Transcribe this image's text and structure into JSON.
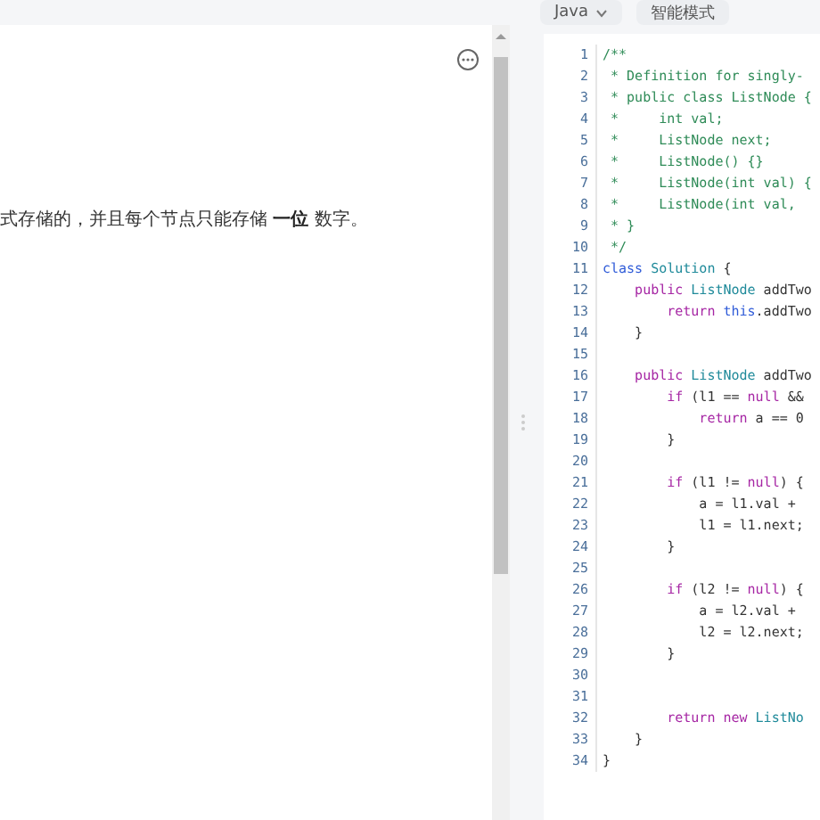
{
  "toolbar": {
    "buttons": [
      {
        "label": "Java",
        "kind": "dropdown"
      },
      {
        "label": "智能模式",
        "kind": "mode"
      }
    ]
  },
  "description": {
    "text": "式存储的，并且每个节点只能存储 **一位** 数字。"
  },
  "editor": {
    "lines": [
      {
        "number": "1",
        "tokens": [
          {
            "kind": "comment",
            "text": "/**"
          }
        ]
      },
      {
        "number": "2",
        "tokens": [
          {
            "kind": "comment",
            "text": " * Definition for singly-"
          }
        ]
      },
      {
        "number": "3",
        "tokens": [
          {
            "kind": "comment",
            "text": " * public class ListNode {"
          }
        ]
      },
      {
        "number": "4",
        "tokens": [
          {
            "kind": "comment",
            "text": " *     int val;"
          }
        ]
      },
      {
        "number": "5",
        "tokens": [
          {
            "kind": "comment",
            "text": " *     ListNode next;"
          }
        ]
      },
      {
        "number": "6",
        "tokens": [
          {
            "kind": "comment",
            "text": " *     ListNode() {}"
          }
        ]
      },
      {
        "number": "7",
        "tokens": [
          {
            "kind": "comment",
            "text": " *     ListNode(int val) {"
          }
        ]
      },
      {
        "number": "8",
        "tokens": [
          {
            "kind": "comment",
            "text": " *     ListNode(int val,"
          }
        ]
      },
      {
        "number": "9",
        "tokens": [
          {
            "kind": "comment",
            "text": " * }"
          }
        ]
      },
      {
        "number": "10",
        "tokens": [
          {
            "kind": "comment",
            "text": " */"
          }
        ]
      },
      {
        "number": "11",
        "tokens": [
          {
            "kind": "declaration",
            "text": "class"
          },
          {
            "kind": "type",
            "text": " Solution"
          },
          {
            "kind": "plain",
            "text": " {"
          }
        ]
      },
      {
        "number": "12",
        "tokens": [
          {
            "kind": "keyword",
            "text": "    public"
          },
          {
            "kind": "type",
            "text": " ListNode"
          },
          {
            "kind": "plain",
            "text": " addTwo"
          }
        ]
      },
      {
        "number": "13",
        "tokens": [
          {
            "kind": "keyword",
            "text": "        return"
          },
          {
            "kind": "declaration",
            "text": " this"
          },
          {
            "kind": "plain",
            "text": ".addTwo"
          }
        ]
      },
      {
        "number": "14",
        "tokens": [
          {
            "kind": "plain",
            "text": "    }"
          }
        ]
      },
      {
        "number": "15"
      },
      {
        "number": "16",
        "tokens": [
          {
            "kind": "keyword",
            "text": "    public"
          },
          {
            "kind": "type",
            "text": " ListNode"
          },
          {
            "kind": "plain",
            "text": " addTwo"
          }
        ]
      },
      {
        "number": "17",
        "tokens": [
          {
            "kind": "keyword",
            "text": "        if"
          },
          {
            "kind": "plain",
            "text": " (l1 =="
          },
          {
            "kind": "keyword",
            "text": " null"
          },
          {
            "kind": "plain",
            "text": " &&"
          }
        ]
      },
      {
        "number": "18",
        "tokens": [
          {
            "kind": "keyword",
            "text": "            return"
          },
          {
            "kind": "plain",
            "text": " a == 0"
          }
        ]
      },
      {
        "number": "19",
        "tokens": [
          {
            "kind": "plain",
            "text": "        }"
          }
        ]
      },
      {
        "number": "20"
      },
      {
        "number": "21",
        "tokens": [
          {
            "kind": "keyword",
            "text": "        if"
          },
          {
            "kind": "plain",
            "text": " (l1 !="
          },
          {
            "kind": "keyword",
            "text": " null"
          },
          {
            "kind": "plain",
            "text": ") {"
          }
        ]
      },
      {
        "number": "22",
        "tokens": [
          {
            "kind": "plain",
            "text": "            a = l1.val +"
          }
        ]
      },
      {
        "number": "23",
        "tokens": [
          {
            "kind": "plain",
            "text": "            l1 = l1.next;"
          }
        ]
      },
      {
        "number": "24",
        "tokens": [
          {
            "kind": "plain",
            "text": "        }"
          }
        ]
      },
      {
        "number": "25"
      },
      {
        "number": "26",
        "tokens": [
          {
            "kind": "keyword",
            "text": "        if"
          },
          {
            "kind": "plain",
            "text": " (l2 !="
          },
          {
            "kind": "keyword",
            "text": " null"
          },
          {
            "kind": "plain",
            "text": ") {"
          }
        ]
      },
      {
        "number": "27",
        "tokens": [
          {
            "kind": "plain",
            "text": "            a = l2.val +"
          }
        ]
      },
      {
        "number": "28",
        "tokens": [
          {
            "kind": "plain",
            "text": "            l2 = l2.next;"
          }
        ]
      },
      {
        "number": "29",
        "tokens": [
          {
            "kind": "plain",
            "text": "        }"
          }
        ]
      },
      {
        "number": "30"
      },
      {
        "number": "31"
      },
      {
        "number": "32",
        "tokens": [
          {
            "kind": "keyword",
            "text": "        return"
          },
          {
            "kind": "keyword",
            "text": " new"
          },
          {
            "kind": "type",
            "text": " ListNo"
          }
        ]
      },
      {
        "number": "33",
        "tokens": [
          {
            "kind": "plain",
            "text": "    }"
          }
        ]
      },
      {
        "number": "34",
        "tokens": [
          {
            "kind": "plain",
            "text": "}"
          }
        ]
      }
    ]
  }
}
